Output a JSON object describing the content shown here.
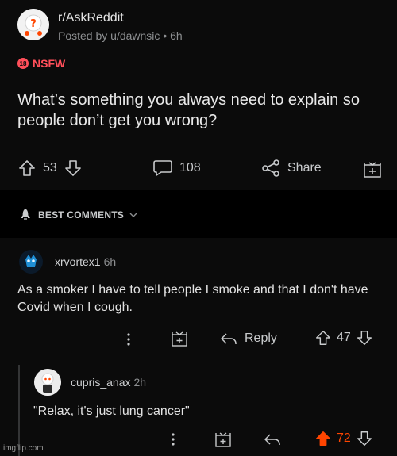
{
  "post": {
    "subreddit": "r/AskReddit",
    "posted_by": "Posted by u/dawnsic • 6h",
    "nsfw_label": "NSFW",
    "nsfw_badge": "18",
    "title": "What’s something you always need to explain so people don’t get you wrong?",
    "upvotes": "53",
    "comments": "108",
    "share_label": "Share"
  },
  "best_comments_label": "BEST COMMENTS",
  "comments": [
    {
      "username": "xrvortex1",
      "time": "6h",
      "text": "As a smoker I have to tell people I smoke and that I don't have Covid when I cough.",
      "reply_label": "Reply",
      "votes": "47"
    },
    {
      "username": "cupris_anax",
      "time": "2h",
      "text": "\"Relax, it's just lung cancer\"",
      "votes": "72"
    }
  ],
  "watermark": "imgflip.com",
  "colors": {
    "accent_orange": "#ff4500",
    "nsfw_red": "#ff4f5a",
    "background": "#0b0b0b"
  },
  "icons": [
    "upvote-icon",
    "downvote-icon",
    "comment-icon",
    "share-icon",
    "award-icon",
    "rocket-icon",
    "chevron-down-icon",
    "more-icon",
    "reply-icon"
  ]
}
